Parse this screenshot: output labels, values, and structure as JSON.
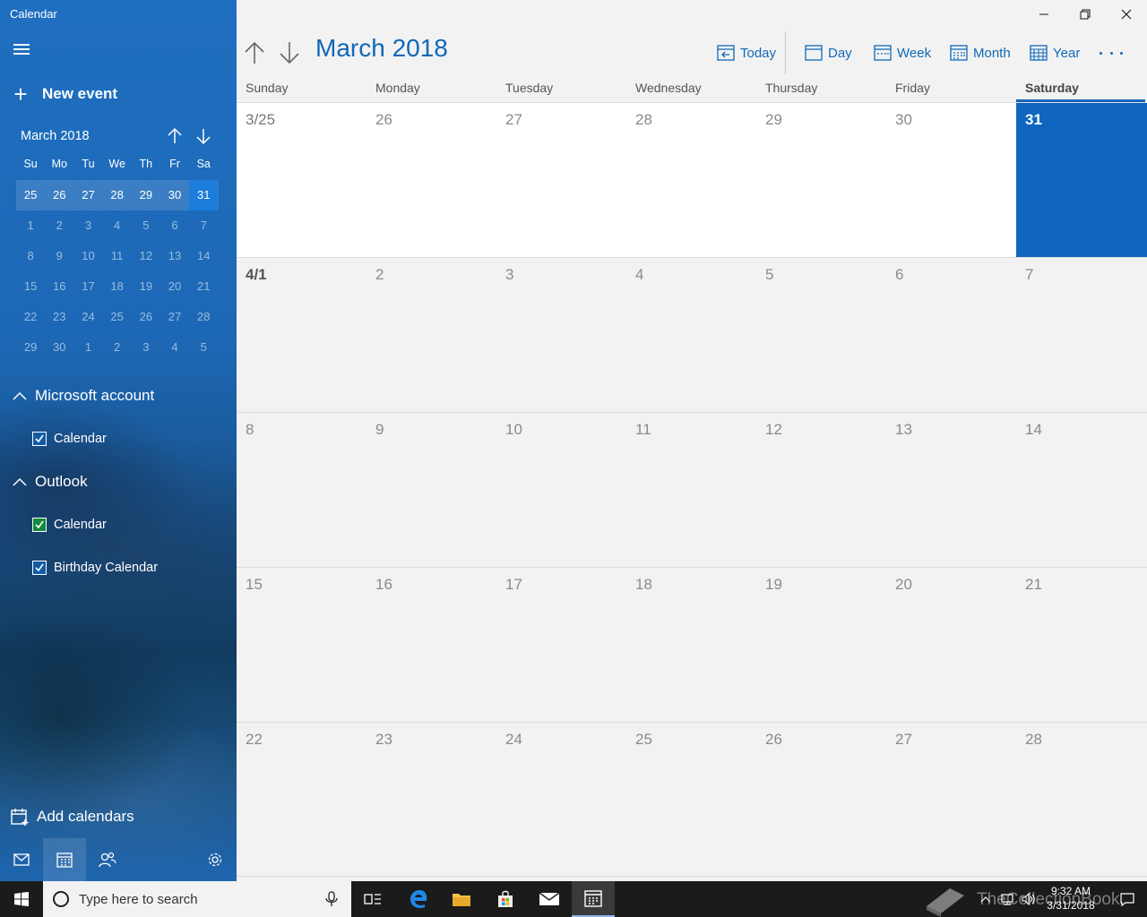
{
  "app": {
    "title": "Calendar"
  },
  "sidebar": {
    "new_event_label": "New event",
    "mini_calendar": {
      "title": "March 2018",
      "weekdays": [
        "Su",
        "Mo",
        "Tu",
        "We",
        "Th",
        "Fr",
        "Sa"
      ],
      "weeks": [
        [
          "25",
          "26",
          "27",
          "28",
          "29",
          "30",
          "31"
        ],
        [
          "1",
          "2",
          "3",
          "4",
          "5",
          "6",
          "7"
        ],
        [
          "8",
          "9",
          "10",
          "11",
          "12",
          "13",
          "14"
        ],
        [
          "15",
          "16",
          "17",
          "18",
          "19",
          "20",
          "21"
        ],
        [
          "22",
          "23",
          "24",
          "25",
          "26",
          "27",
          "28"
        ],
        [
          "29",
          "30",
          "1",
          "2",
          "3",
          "4",
          "5"
        ]
      ],
      "current_week_index": 0,
      "today_index": 6
    },
    "groups": [
      {
        "name": "Microsoft account",
        "calendars": [
          {
            "name": "Calendar",
            "checked": true,
            "color": "#0f5ca8"
          }
        ]
      },
      {
        "name": "Outlook",
        "calendars": [
          {
            "name": "Calendar",
            "checked": true,
            "color": "#108a3e"
          },
          {
            "name": "Birthday Calendar",
            "checked": true,
            "color": "#0f5ca8"
          }
        ]
      }
    ],
    "add_calendars_label": "Add calendars"
  },
  "toolbar": {
    "month_title": "March 2018",
    "today_label": "Today",
    "day_label": "Day",
    "week_label": "Week",
    "month_label": "Month",
    "year_label": "Year"
  },
  "calendar": {
    "weekday_headers": [
      "Sunday",
      "Monday",
      "Tuesday",
      "Wednesday",
      "Thursday",
      "Friday",
      "Saturday"
    ],
    "selected_weekday_index": 6,
    "weeks": [
      [
        "3/25",
        "26",
        "27",
        "28",
        "29",
        "30",
        "31"
      ],
      [
        "4/1",
        "2",
        "3",
        "4",
        "5",
        "6",
        "7"
      ],
      [
        "8",
        "9",
        "10",
        "11",
        "12",
        "13",
        "14"
      ],
      [
        "15",
        "16",
        "17",
        "18",
        "19",
        "20",
        "21"
      ],
      [
        "22",
        "23",
        "24",
        "25",
        "26",
        "27",
        "28"
      ]
    ],
    "today": {
      "week": 0,
      "day": 6
    },
    "accent_color": "#1066bf"
  },
  "taskbar": {
    "search_placeholder": "Type here to search",
    "time": "9:32 AM",
    "date": "3/31/2018",
    "watermark": "TheCollectionBook"
  }
}
